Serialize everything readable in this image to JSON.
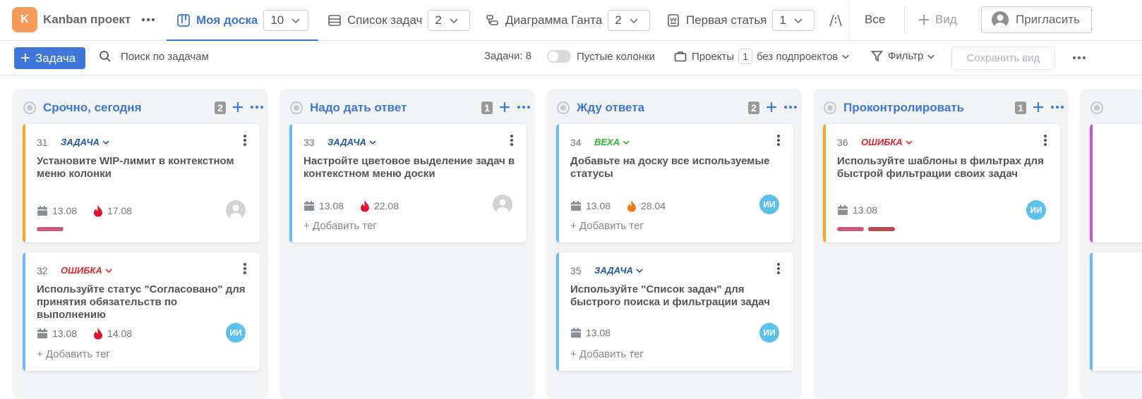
{
  "app": {
    "logo_letter": "K",
    "logo_color": "#f59a5a",
    "project_name": "Kanban проект",
    "accent_color": "#3d77d9"
  },
  "views": [
    {
      "label": "Моя доска",
      "count": "10",
      "icon": "kanban-board-icon",
      "active": true
    },
    {
      "label": "Список задач",
      "count": "2",
      "icon": "list-icon",
      "active": false
    },
    {
      "label": "Диаграмма Ганта",
      "count": "2",
      "icon": "gantt-icon",
      "active": false
    },
    {
      "label": "Первая статья",
      "count": "1",
      "icon": "document-icon",
      "active": false
    }
  ],
  "top_right": {
    "all_label": "Все",
    "view_label": "Вид",
    "invite_label": "Пригласить"
  },
  "toolbar": {
    "task_label": "Задача",
    "search_placeholder": "Поиск по задачам",
    "tasks_count": "Задачи: 8",
    "empty_columns_label": "Пустые колонки",
    "empty_columns_on": false,
    "projects_label": "Проекты",
    "projects_count": "1",
    "subprojects_label": "без подпроектов",
    "filter_label": "Фильтр",
    "save_view_label": "Сохранить вид"
  },
  "columns": [
    {
      "title": "Срочно, сегодня",
      "count": "2",
      "cards": [
        {
          "num": "31",
          "type": "ЗАДАЧА",
          "type_color": "#2456a6",
          "text": "Установите WIP-лимит в контекстном меню колонки",
          "stripe_color": "#f5a623",
          "date": "13.08",
          "due": "17.08",
          "due_color": "#e0142a",
          "avatar": "",
          "avatar_kind": "gray",
          "add_tag": "",
          "tag_colors": [
            "#c75a7f"
          ]
        },
        {
          "num": "32",
          "type": "ОШИБКА",
          "type_color": "#e0262e",
          "text": "Используйте статус \"Согласовано\" для принятия обязательств по выполнению",
          "stripe_color": "#6ab8f7",
          "date": "13.08",
          "due": "14.08",
          "due_color": "#e0142a",
          "avatar": "ИИ",
          "avatar_kind": "blue",
          "add_tag": "+ Добавить тег",
          "tag_colors": []
        }
      ]
    },
    {
      "title": "Надо дать ответ",
      "count": "1",
      "cards": [
        {
          "num": "33",
          "type": "ЗАДАЧА",
          "type_color": "#2456a6",
          "text": "Настройте цветовое выделение задач в контекстном меню доски",
          "stripe_color": "#6ab8f7",
          "date": "13.08",
          "due": "22.08",
          "due_color": "#e0142a",
          "avatar": "",
          "avatar_kind": "gray",
          "add_tag": "+ Добавить тег",
          "tag_colors": []
        }
      ]
    },
    {
      "title": "Жду ответа",
      "count": "2",
      "cards": [
        {
          "num": "34",
          "type": "ВЕХА",
          "type_color": "#2eb82e",
          "text": "Добавьте на доску все используемые статусы",
          "stripe_color": "#6ab8f7",
          "date": "13.08",
          "due": "28.04",
          "due_color": "#f07a1a",
          "avatar": "ИИ",
          "avatar_kind": "blue",
          "add_tag": "+ Добавить тег",
          "tag_colors": []
        },
        {
          "num": "35",
          "type": "ЗАДАЧА",
          "type_color": "#2456a6",
          "text": "Используйте \"Список задач\" для быстрого поиска и фильтрации задач",
          "stripe_color": "#6ab8f7",
          "date": "13.08",
          "due": "",
          "due_color": "",
          "avatar": "ИИ",
          "avatar_kind": "blue",
          "add_tag": "+ Добавить тег",
          "tag_colors": []
        }
      ]
    },
    {
      "title": "Проконтролировать",
      "count": "1",
      "cards": [
        {
          "num": "36",
          "type": "ОШИБКА",
          "type_color": "#e0262e",
          "text": "Используйте шаблоны в фильтрах для быстрой фильтрации своих задач",
          "stripe_color": "#f5a623",
          "date": "13.08",
          "due": "",
          "due_color": "",
          "avatar": "ИИ",
          "avatar_kind": "blue",
          "add_tag": "",
          "tag_colors": [
            "#c75a7f",
            "#b84a55"
          ]
        }
      ]
    }
  ]
}
